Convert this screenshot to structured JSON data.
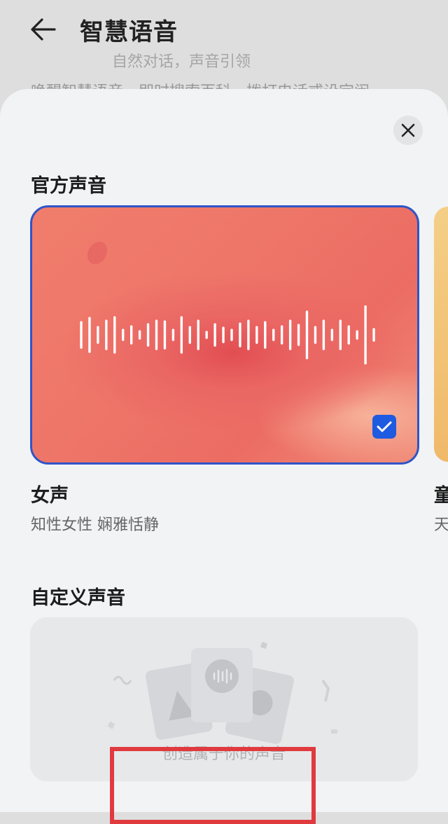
{
  "header": {
    "title": "智慧语音",
    "back_icon": "arrow-left-icon"
  },
  "background": {
    "line1": "自然对话，声音引领",
    "line2": "唤醒智慧语音，即时搜索百科，拨打电话或设定闹"
  },
  "sheet": {
    "close_icon": "close-icon",
    "official_section_title": "官方声音",
    "voices": [
      {
        "name": "女声",
        "description": "知性女性 娴雅恬静",
        "selected": true,
        "accent": "#2f55c8"
      },
      {
        "name": "童",
        "description": "天"
      }
    ],
    "custom_section_title": "自定义声音",
    "custom_label": "创造属于你的声音"
  },
  "colors": {
    "selection_border": "#2f55c8",
    "checkbox": "#1f5be0",
    "highlight_box": "#e03a3f"
  }
}
